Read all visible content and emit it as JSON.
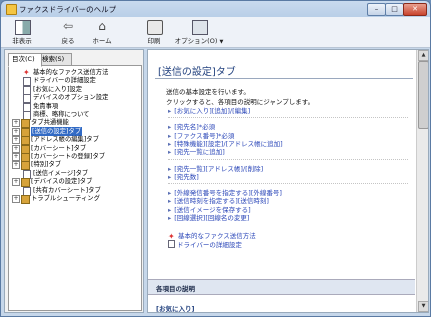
{
  "window": {
    "title": "ファクスドライバーのヘルプ",
    "controls": {
      "minimize": "–",
      "maximize": "□",
      "close": "✕"
    }
  },
  "toolbar": {
    "hide": "非表示",
    "back": "戻る",
    "home": "ホーム",
    "print": "印刷",
    "options": "オプション(O)",
    "options_dropdown": "▼"
  },
  "left_pane": {
    "tabs": [
      "目次(C)",
      "検索(S)"
    ],
    "active_tab": 0,
    "tree": [
      {
        "label": "基本的なファクス送信方法",
        "icon": "star-icon",
        "expand": ""
      },
      {
        "label": "ドライバーの詳細設定",
        "icon": "page-icon",
        "expand": ""
      },
      {
        "label": "[お気に入り]設定",
        "icon": "page-icon",
        "expand": ""
      },
      {
        "label": "デバイスのオプション設定",
        "icon": "page-icon",
        "expand": ""
      },
      {
        "label": "免責事項",
        "icon": "page-icon",
        "expand": ""
      },
      {
        "label": "商標、略称について",
        "icon": "page-icon",
        "expand": ""
      },
      {
        "label": "タブ共通機能",
        "icon": "book-icon",
        "expand": "+"
      },
      {
        "label": "[送信の設定]タブ",
        "icon": "book-icon",
        "expand": "+",
        "selected": true
      },
      {
        "label": "[アドレス帳の編集]タブ",
        "icon": "book-icon",
        "expand": "+"
      },
      {
        "label": "[カバーシート]タブ",
        "icon": "book-icon",
        "expand": "+"
      },
      {
        "label": "[カバーシートの登録]タブ",
        "icon": "book-icon",
        "expand": "+"
      },
      {
        "label": "[特別]タブ",
        "icon": "book-icon",
        "expand": "+"
      },
      {
        "label": "[送信イメージ]タブ",
        "icon": "page-icon",
        "expand": ""
      },
      {
        "label": "[デバイスの設定]タブ",
        "icon": "book-icon",
        "expand": "+"
      },
      {
        "label": "[共有カバーシート]タブ",
        "icon": "page-icon",
        "expand": ""
      },
      {
        "label": "トラブルシューティング",
        "icon": "book-icon",
        "expand": "+"
      }
    ]
  },
  "content": {
    "title": "[送信の設定]タブ",
    "intro_1": "送信の基本設定を行います。",
    "intro_2": "クリックすると、各項目の説明にジャンプします。",
    "arrow": "▸",
    "group_1": [
      "[お気に入り][追加]/[編集]"
    ],
    "group_2": [
      "[宛先名]*必須",
      "[ファクス番号]*必須",
      "[特殊機能][設定]/[アドレス帳に追加]",
      "[宛先一覧に追加]"
    ],
    "group_3": [
      "[宛先一覧][アドレス帳]/[削除]",
      "[宛先数]"
    ],
    "group_4": [
      "[外線発信番号を指定する][外線番号]",
      "[送信時刻を指定する][送信時刻]",
      "[送信イメージを保存する]",
      "[回線選択][回線名の変更]"
    ],
    "related": [
      {
        "label": "基本的なファクス送信方法",
        "icon": "star-icon"
      },
      {
        "label": "ドライバーの詳細設定",
        "icon": "page-icon"
      }
    ],
    "section_heading": "各項目の説明",
    "sub_heading": "[お気に入り]"
  },
  "scrollbar": {
    "up": "▲",
    "down": "▼"
  }
}
